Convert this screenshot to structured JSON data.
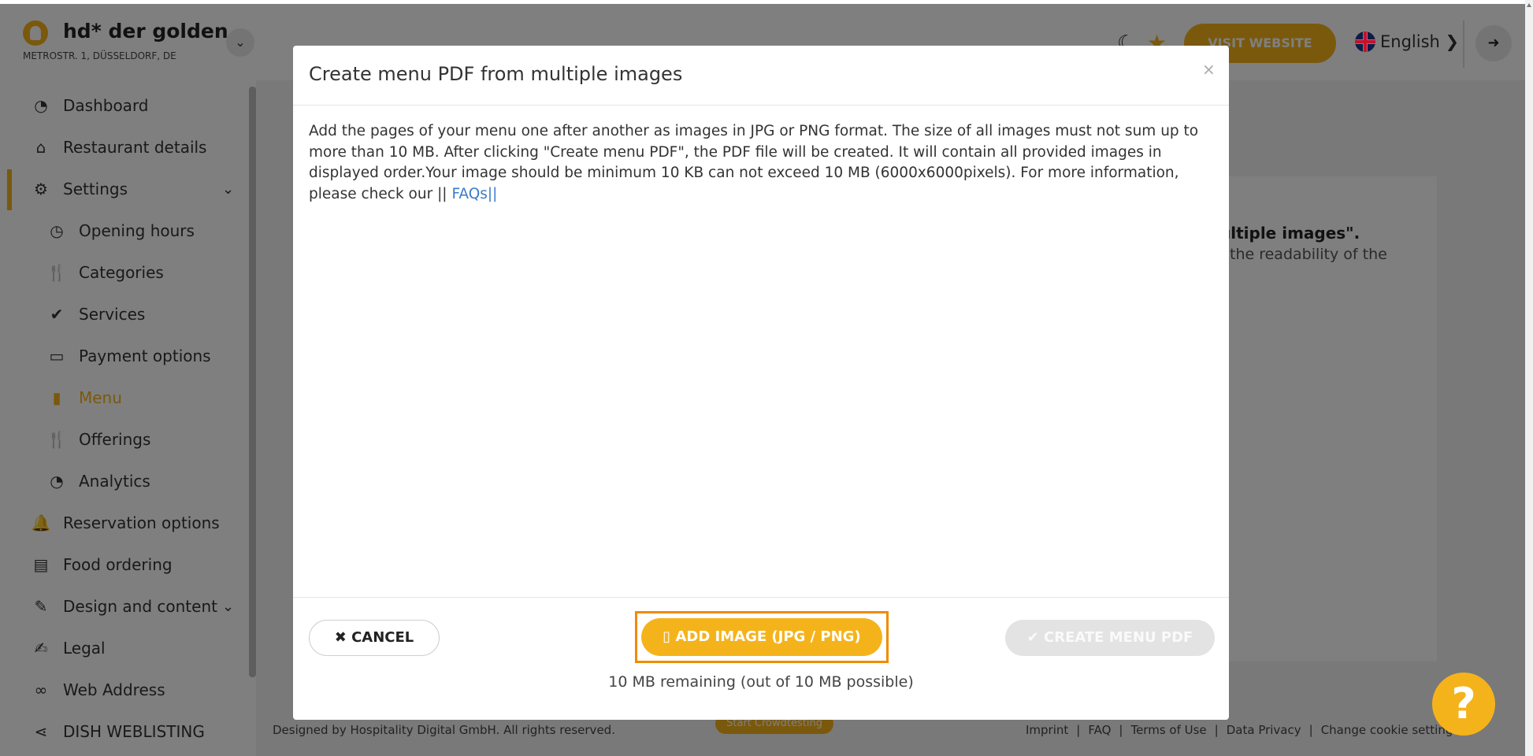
{
  "header": {
    "restaurant_name": "hd* der golden...",
    "address": "METROSTR. 1, DÜSSELDORF, DE",
    "visit_website": "VISIT WEBSITE",
    "language": "English ❯"
  },
  "sidebar": {
    "items": [
      {
        "label": "Dashboard",
        "icon": "dashboard-icon"
      },
      {
        "label": "Restaurant details",
        "icon": "home-icon"
      },
      {
        "label": "Settings",
        "icon": "gear-icon"
      },
      {
        "label": "Opening hours",
        "icon": "clock-icon"
      },
      {
        "label": "Categories",
        "icon": "cutlery-icon"
      },
      {
        "label": "Services",
        "icon": "check-circle-icon"
      },
      {
        "label": "Payment options",
        "icon": "credit-card-icon"
      },
      {
        "label": "Menu",
        "icon": "menu-book-icon"
      },
      {
        "label": "Offerings",
        "icon": "cutlery-icon"
      },
      {
        "label": "Analytics",
        "icon": "analytics-icon"
      },
      {
        "label": "Reservation options",
        "icon": "bell-icon"
      },
      {
        "label": "Food ordering",
        "icon": "food-ordering-icon"
      },
      {
        "label": "Design and content",
        "icon": "brush-icon"
      },
      {
        "label": "Legal",
        "icon": "legal-icon"
      },
      {
        "label": "Web Address",
        "icon": "link-icon"
      },
      {
        "label": "DISH WEBLISTING",
        "icon": "share-icon"
      }
    ]
  },
  "background": {
    "peek_bold": "ultiple images\".",
    "peek_text": "the readability of the",
    "footer_left": "Designed by Hospitality Digital GmbH. All rights reserved.",
    "crowd_button": "Start Crowdtesting",
    "footer_links": [
      "Imprint",
      "FAQ",
      "Terms of Use",
      "Data Privacy",
      "Change cookie settings"
    ]
  },
  "modal": {
    "title": "Create menu PDF from multiple images",
    "close": "×",
    "body_text": "Add the pages of your menu one after another as images in JPG or PNG format. The size of all images must not sum up to more than 10 MB. After clicking \"Create menu PDF\", the PDF file will be created. It will contain all provided images in displayed order.Your image should be minimum 10 KB can not exceed 10 MB (6000x6000pixels). For more information, please check our || ",
    "faq_link": "FAQs",
    "body_end": "||",
    "cancel_label": "✖ CANCEL",
    "add_image_label": "ADD IMAGE (JPG / PNG)",
    "create_label": "✔ CREATE MENU PDF",
    "remaining": "10 MB remaining (out of 10 MB possible)"
  },
  "help": "?"
}
